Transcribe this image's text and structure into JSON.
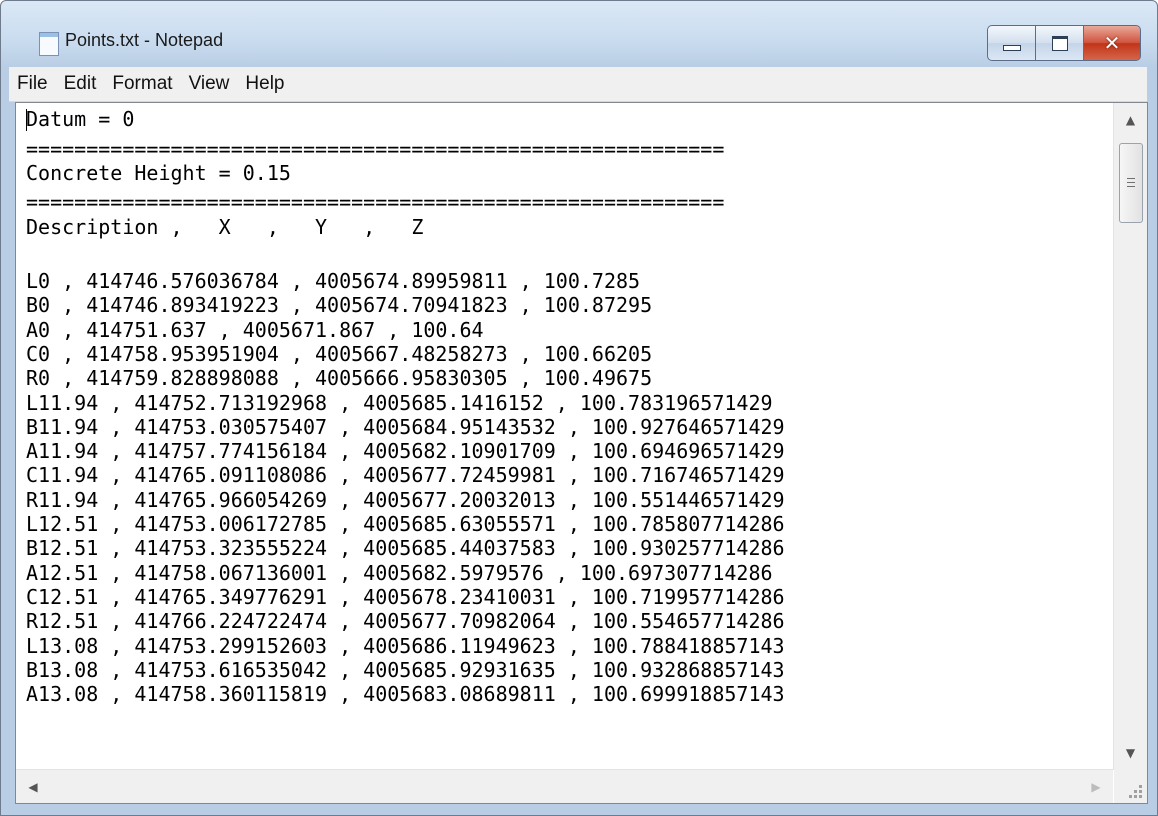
{
  "window": {
    "title": "Points.txt - Notepad",
    "icon": "notepad-icon",
    "buttons": {
      "minimize": "minimize-icon",
      "maximize": "maximize-icon",
      "close": "close-icon",
      "close_color": "#c23418"
    }
  },
  "menu": {
    "items": [
      "File",
      "Edit",
      "Format",
      "View",
      "Help"
    ]
  },
  "document": {
    "lines": [
      "Datum = 0",
      "==========================================================",
      "Concrete Height = 0.15",
      "==========================================================",
      "Description ,   X   ,   Y   ,   Z",
      "",
      "L0 , 414746.576036784 , 4005674.89959811 , 100.7285",
      "B0 , 414746.893419223 , 4005674.70941823 , 100.87295",
      "A0 , 414751.637 , 4005671.867 , 100.64",
      "C0 , 414758.953951904 , 4005667.48258273 , 100.66205",
      "R0 , 414759.828898088 , 4005666.95830305 , 100.49675",
      "L11.94 , 414752.713192968 , 4005685.1416152 , 100.783196571429",
      "B11.94 , 414753.030575407 , 4005684.95143532 , 100.927646571429",
      "A11.94 , 414757.774156184 , 4005682.10901709 , 100.694696571429",
      "C11.94 , 414765.091108086 , 4005677.72459981 , 100.716746571429",
      "R11.94 , 414765.966054269 , 4005677.20032013 , 100.551446571429",
      "L12.51 , 414753.006172785 , 4005685.63055571 , 100.785807714286",
      "B12.51 , 414753.323555224 , 4005685.44037583 , 100.930257714286",
      "A12.51 , 414758.067136001 , 4005682.5979576 , 100.697307714286",
      "C12.51 , 414765.349776291 , 4005678.23410031 , 100.719957714286",
      "R12.51 , 414766.224722474 , 4005677.70982064 , 100.554657714286",
      "L13.08 , 414753.299152603 , 4005686.11949623 , 100.788418857143",
      "B13.08 , 414753.616535042 , 4005685.92931635 , 100.932868857143",
      "A13.08 , 414758.360115819 , 4005683.08689811 , 100.699918857143"
    ]
  },
  "scrollbars": {
    "vertical": {
      "up": "scroll-up-arrow-icon",
      "down": "scroll-down-arrow-icon",
      "grip": "grip-icon"
    },
    "horizontal": {
      "left": "scroll-left-arrow-icon",
      "right": "scroll-right-arrow-icon"
    },
    "size_grip": "resize-grip-icon"
  }
}
